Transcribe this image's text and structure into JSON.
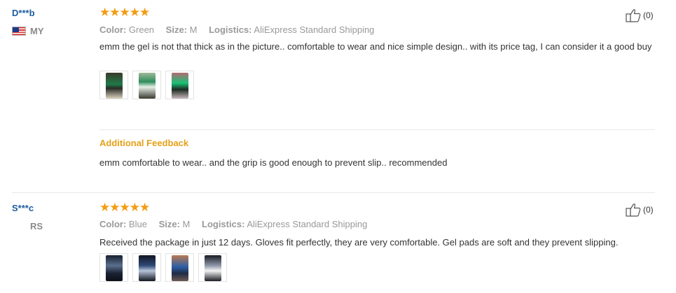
{
  "colors": {
    "username": "#1f5d9e",
    "stars": "#f39c12",
    "additional_feedback_title": "#e6a019",
    "muted": "#999999"
  },
  "reviews": [
    {
      "user": "D***b",
      "country_code": "MY",
      "has_flag": true,
      "stars": "★★★★★",
      "rating": 5,
      "color_label": "Color:",
      "color_value": "Green",
      "size_label": "Size:",
      "size_value": "M",
      "logistics_label": "Logistics:",
      "logistics_value": "AliExpress Standard Shipping",
      "text": "emm the gel is not that thick as in the picture.. comfortable to wear and nice simple design.. with its price tag, I can consider it a good buy",
      "likes": "(0)",
      "photo_count": 3,
      "additional_feedback": {
        "title": "Additional Feedback",
        "text": "emm comfortable to wear.. and the grip is good enough to prevent slip.. recommended"
      }
    },
    {
      "user": "S***c",
      "country_code": "RS",
      "has_flag": false,
      "stars": "★★★★★",
      "rating": 5,
      "color_label": "Color:",
      "color_value": "Blue",
      "size_label": "Size:",
      "size_value": "M",
      "logistics_label": "Logistics:",
      "logistics_value": "AliExpress Standard Shipping",
      "text": "Received the package in just 12 days. Gloves fit perfectly, they are very comfortable. Gel pads are soft and they prevent slipping.",
      "likes": "(0)",
      "photo_count": 4
    }
  ]
}
